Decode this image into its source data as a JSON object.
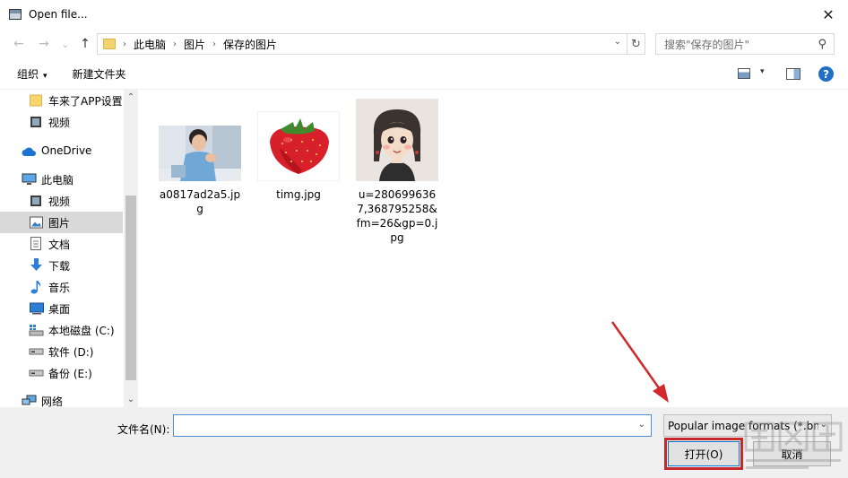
{
  "window": {
    "title": "Open file...",
    "close_glyph": "✕"
  },
  "nav": {
    "back_glyph": "←",
    "forward_glyph": "→",
    "recent_glyph": "⌄",
    "up_glyph": "↑",
    "crumbs": [
      "此电脑",
      "图片",
      "保存的图片"
    ],
    "crumb_sep": "›",
    "dropdown_glyph": "⌄",
    "refresh_glyph": "↻",
    "search_placeholder": "搜索\"保存的图片\"",
    "search_glyph": "⚲"
  },
  "toolbar": {
    "organize_label": "组织",
    "organize_caret": "▾",
    "new_folder_label": "新建文件夹",
    "view_caret": "▾",
    "help_glyph": "?"
  },
  "sidebar": {
    "items": [
      {
        "label": "车来了APP设置",
        "icon": "folder-icon"
      },
      {
        "label": "视频",
        "icon": "video-icon"
      },
      {
        "label": "OneDrive",
        "icon": "cloud-icon"
      },
      {
        "label": "此电脑",
        "icon": "computer-icon"
      },
      {
        "label": "视频",
        "icon": "video-icon"
      },
      {
        "label": "图片",
        "icon": "pictures-icon",
        "selected": true
      },
      {
        "label": "文档",
        "icon": "document-icon"
      },
      {
        "label": "下载",
        "icon": "download-icon"
      },
      {
        "label": "音乐",
        "icon": "music-icon"
      },
      {
        "label": "桌面",
        "icon": "desktop-icon"
      },
      {
        "label": "本地磁盘 (C:)",
        "icon": "system-drive-icon"
      },
      {
        "label": "软件 (D:)",
        "icon": "drive-icon"
      },
      {
        "label": "备份 (E:)",
        "icon": "drive-icon"
      },
      {
        "label": "网络",
        "icon": "network-icon"
      }
    ],
    "scroll_up_glyph": "⌃",
    "scroll_down_glyph": "⌄"
  },
  "files": [
    {
      "name": "a0817ad2a5.jpg",
      "thumb": "photo-boy-thumbnail"
    },
    {
      "name": "timg.jpg",
      "thumb": "strawberry-thumbnail"
    },
    {
      "name": "u=2806996367,368795258&fm=26&gp=0.jpg",
      "thumb": "cartoon-girl-thumbnail"
    }
  ],
  "footer": {
    "filename_label": "文件名(N):",
    "filename_value": "",
    "filename_caret": "⌄",
    "filetype_value": "Popular image formats (*.bn",
    "filetype_caret": "⌄",
    "open_label": "打开(O)",
    "cancel_label": "取消"
  },
  "colors": {
    "accent": "#0078d7",
    "highlight_red": "#c8272c",
    "selection": "#d9d9d9"
  }
}
